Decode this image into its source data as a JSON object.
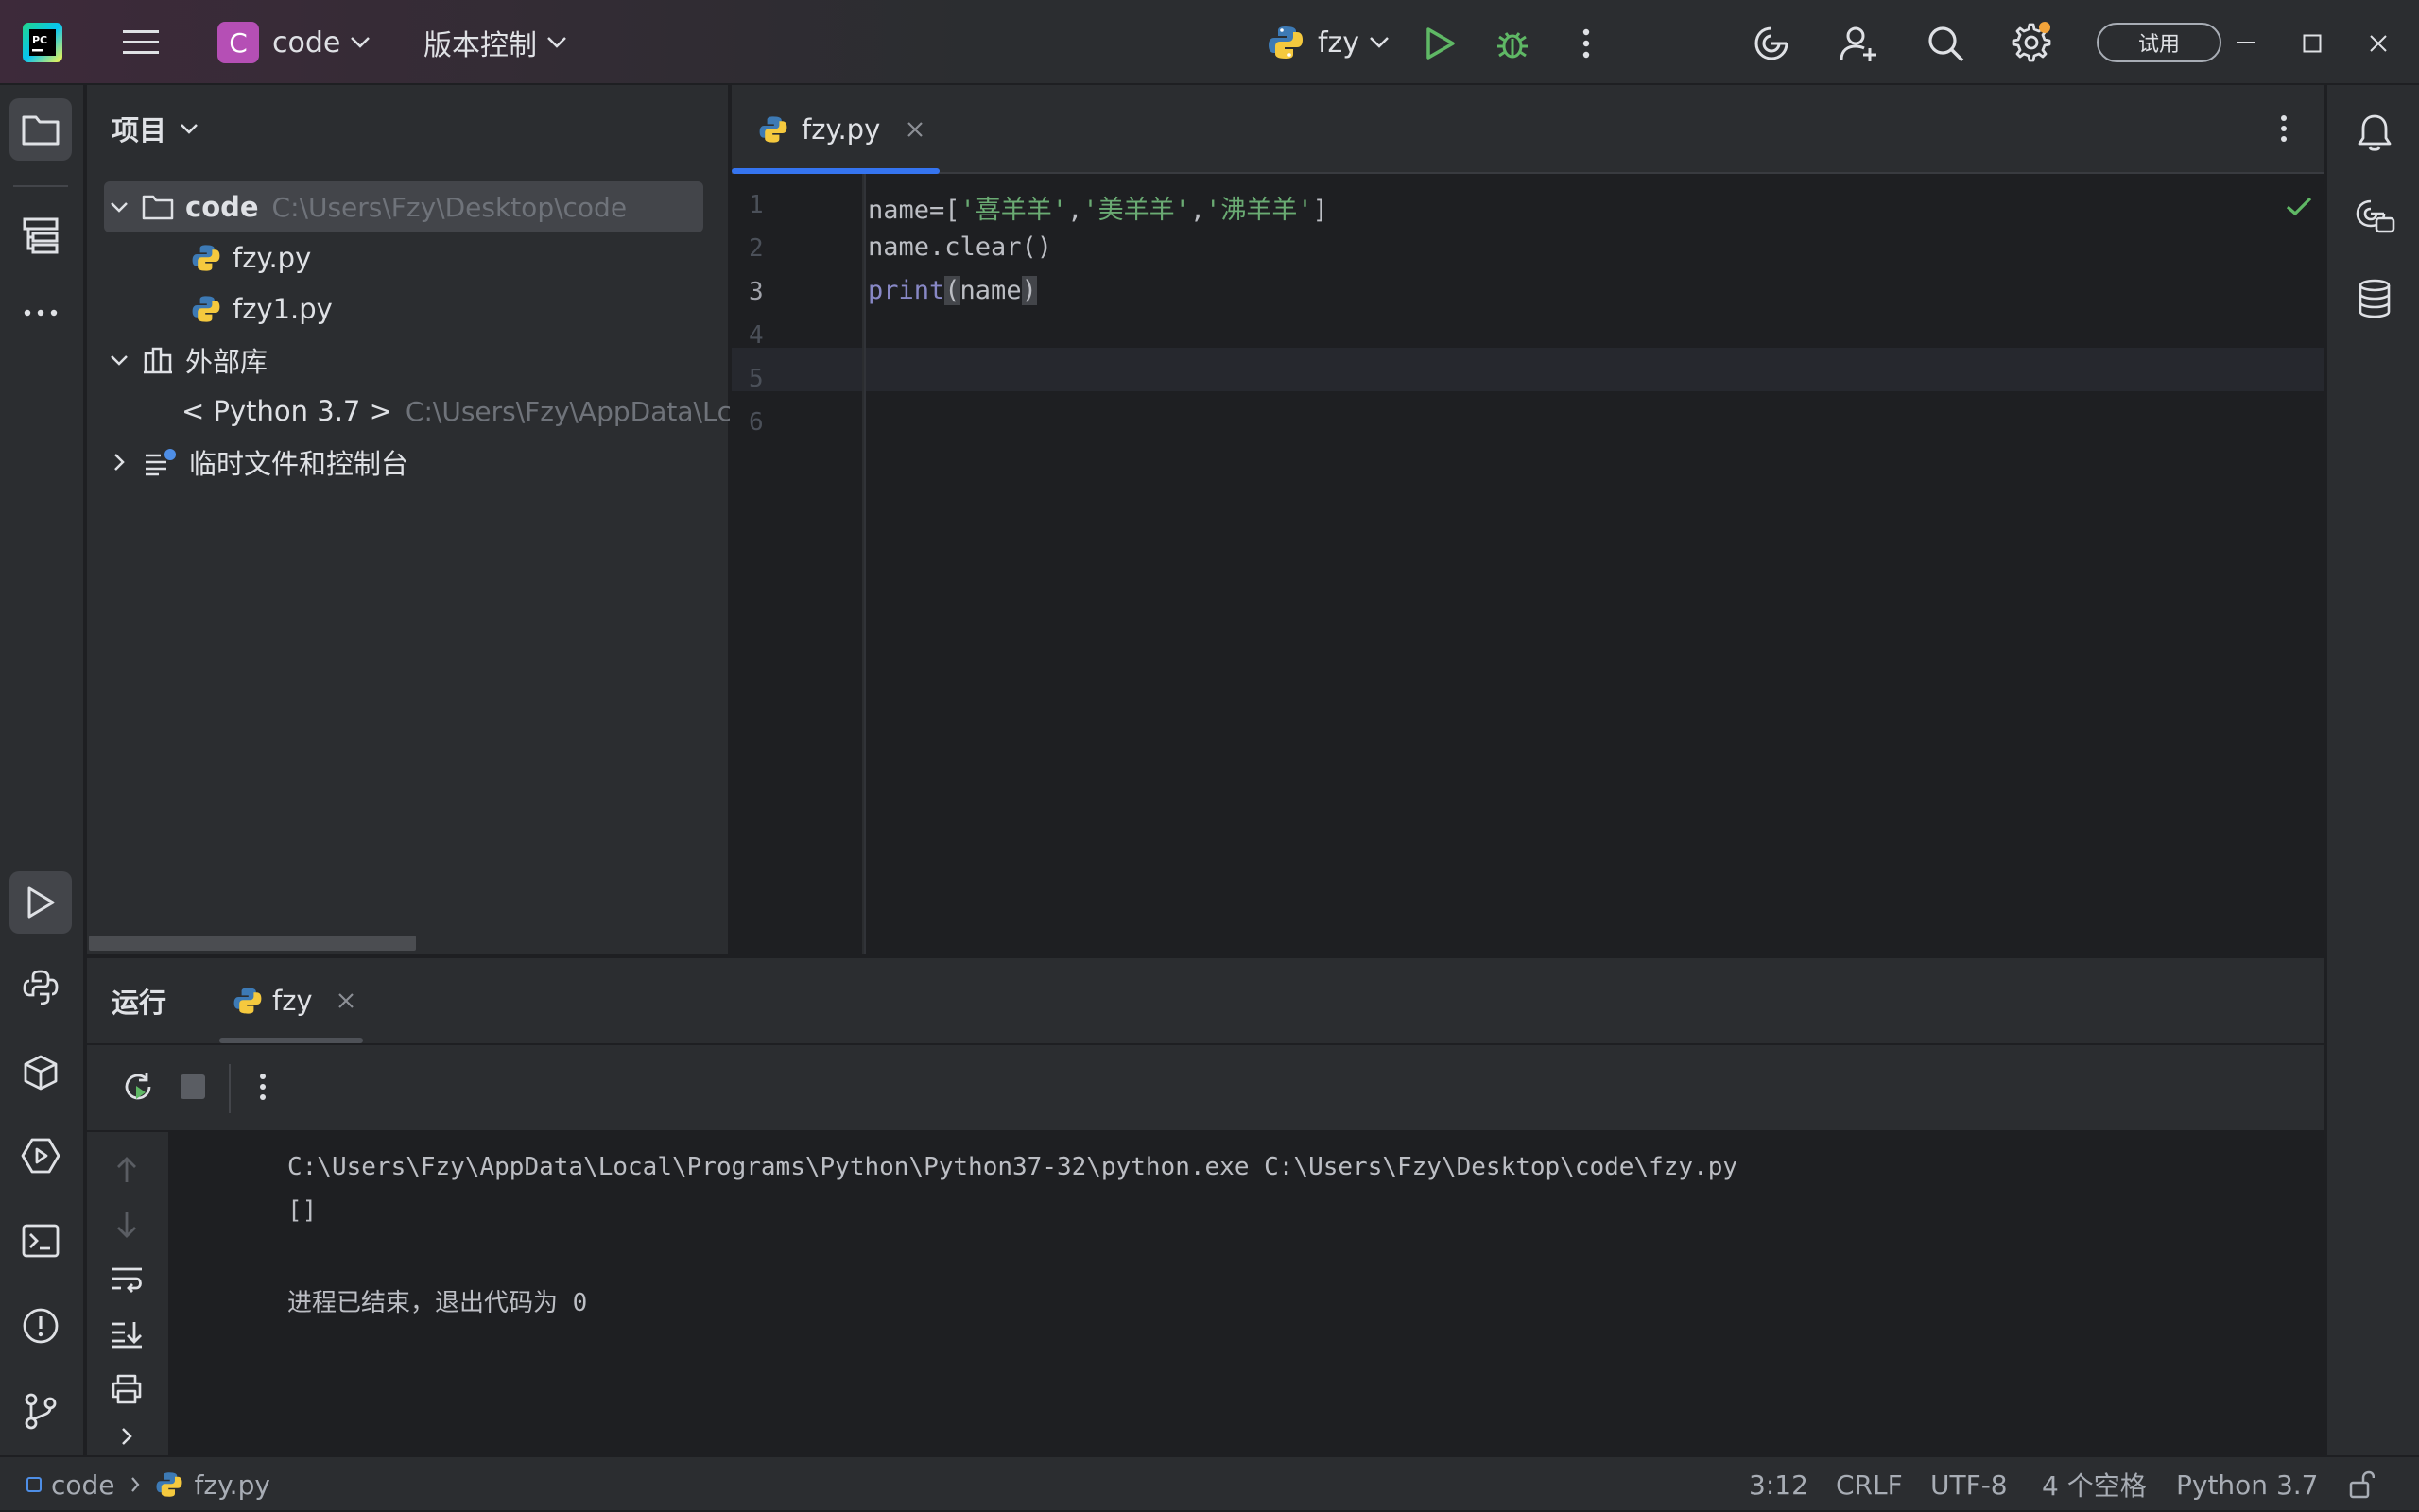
{
  "titlebar": {
    "project_badge": "C",
    "project_name": "code",
    "vcs_menu": "版本控制",
    "run_config": "fzy",
    "trial_badge": "试用",
    "colors": {
      "accent_project": "#b54fb5",
      "run_green": "#5fb865",
      "debug_green": "#5fb865",
      "notify_orange": "#f2a33a"
    }
  },
  "project_panel": {
    "title": "项目",
    "root": {
      "name": "code",
      "path": "C:\\Users\\Fzy\\Desktop\\code"
    },
    "files": [
      "fzy.py",
      "fzy1.py"
    ],
    "external_libs": "外部库",
    "python_sdk": {
      "name": "< Python 3.7 >",
      "path": "C:\\Users\\Fzy\\AppData\\Lc"
    },
    "scratches": "临时文件和控制台"
  },
  "editor": {
    "tab_label": "fzy.py",
    "line_numbers": [
      "1",
      "2",
      "3",
      "4",
      "5",
      "6"
    ],
    "current_line": "3",
    "code": {
      "l1_a": "name=[",
      "l1_s1": "'喜羊羊'",
      "l1_c1": ",",
      "l1_s2": "'美羊羊'",
      "l1_c2": ",",
      "l1_s3": "'沸羊羊'",
      "l1_b": "]",
      "l2": "name.clear()",
      "l3_kw": "print",
      "l3_lp": "(",
      "l3_arg": "name",
      "l3_rp": ")"
    },
    "colors": {
      "string": "#6aab73",
      "builtin": "#8888c6",
      "text": "#bcbec4"
    }
  },
  "run_panel": {
    "title": "运行",
    "tab_label": "fzy",
    "output": {
      "command": "C:\\Users\\Fzy\\AppData\\Local\\Programs\\Python\\Python37-32\\python.exe C:\\Users\\Fzy\\Desktop\\code\\fzy.py",
      "result": "[]",
      "exit_message": "进程已结束，退出代码为 0"
    }
  },
  "statusbar": {
    "crumb_project": "code",
    "crumb_file": "fzy.py",
    "position": "3:12",
    "line_sep": "CRLF",
    "encoding": "UTF-8",
    "indent": "4 个空格",
    "interpreter": "Python 3.7"
  }
}
